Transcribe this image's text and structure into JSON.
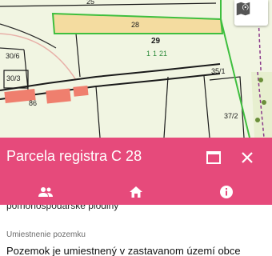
{
  "map": {
    "parcel_labels": [
      "25",
      "28",
      "29",
      "1",
      "1",
      "30/6",
      "30/3",
      "35/1",
      "86",
      "37/2",
      "21"
    ],
    "locate_button_icon": "map-pin-icon"
  },
  "panel": {
    "title": "Parcela registra C 28",
    "maximize_icon": "maximize-icon",
    "close_icon": "close-icon",
    "accent_color": "#e64a7b"
  },
  "tabs": [
    {
      "icon": "people-icon",
      "label": "owners"
    },
    {
      "icon": "home-icon",
      "label": "building"
    },
    {
      "icon": "info-icon",
      "label": "info"
    }
  ],
  "content": {
    "prev_value": "poľnohospodárske plodiny",
    "field_label": "Umiestnenie pozemku",
    "field_value": "Pozemok je umiestnený v zastavanom území obce"
  }
}
